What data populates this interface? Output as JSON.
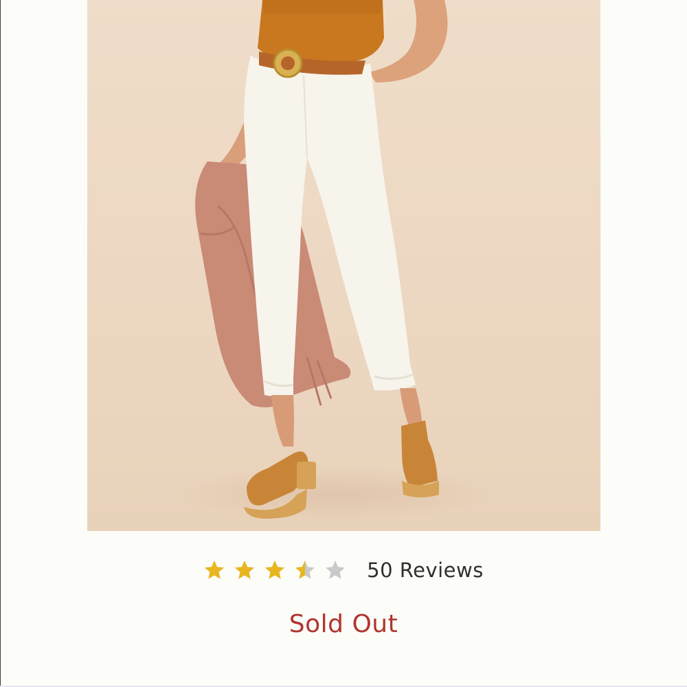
{
  "product": {
    "image_alt": "White cropped pleated pants with belt and tan sandals"
  },
  "rating": {
    "value": 3.5,
    "max": 5,
    "reviews_label": "50 Reviews",
    "colors": {
      "filled": "#e8b61f",
      "empty": "#c9c9c9"
    }
  },
  "availability": {
    "status_label": "Sold Out",
    "color": "#b0342f"
  }
}
